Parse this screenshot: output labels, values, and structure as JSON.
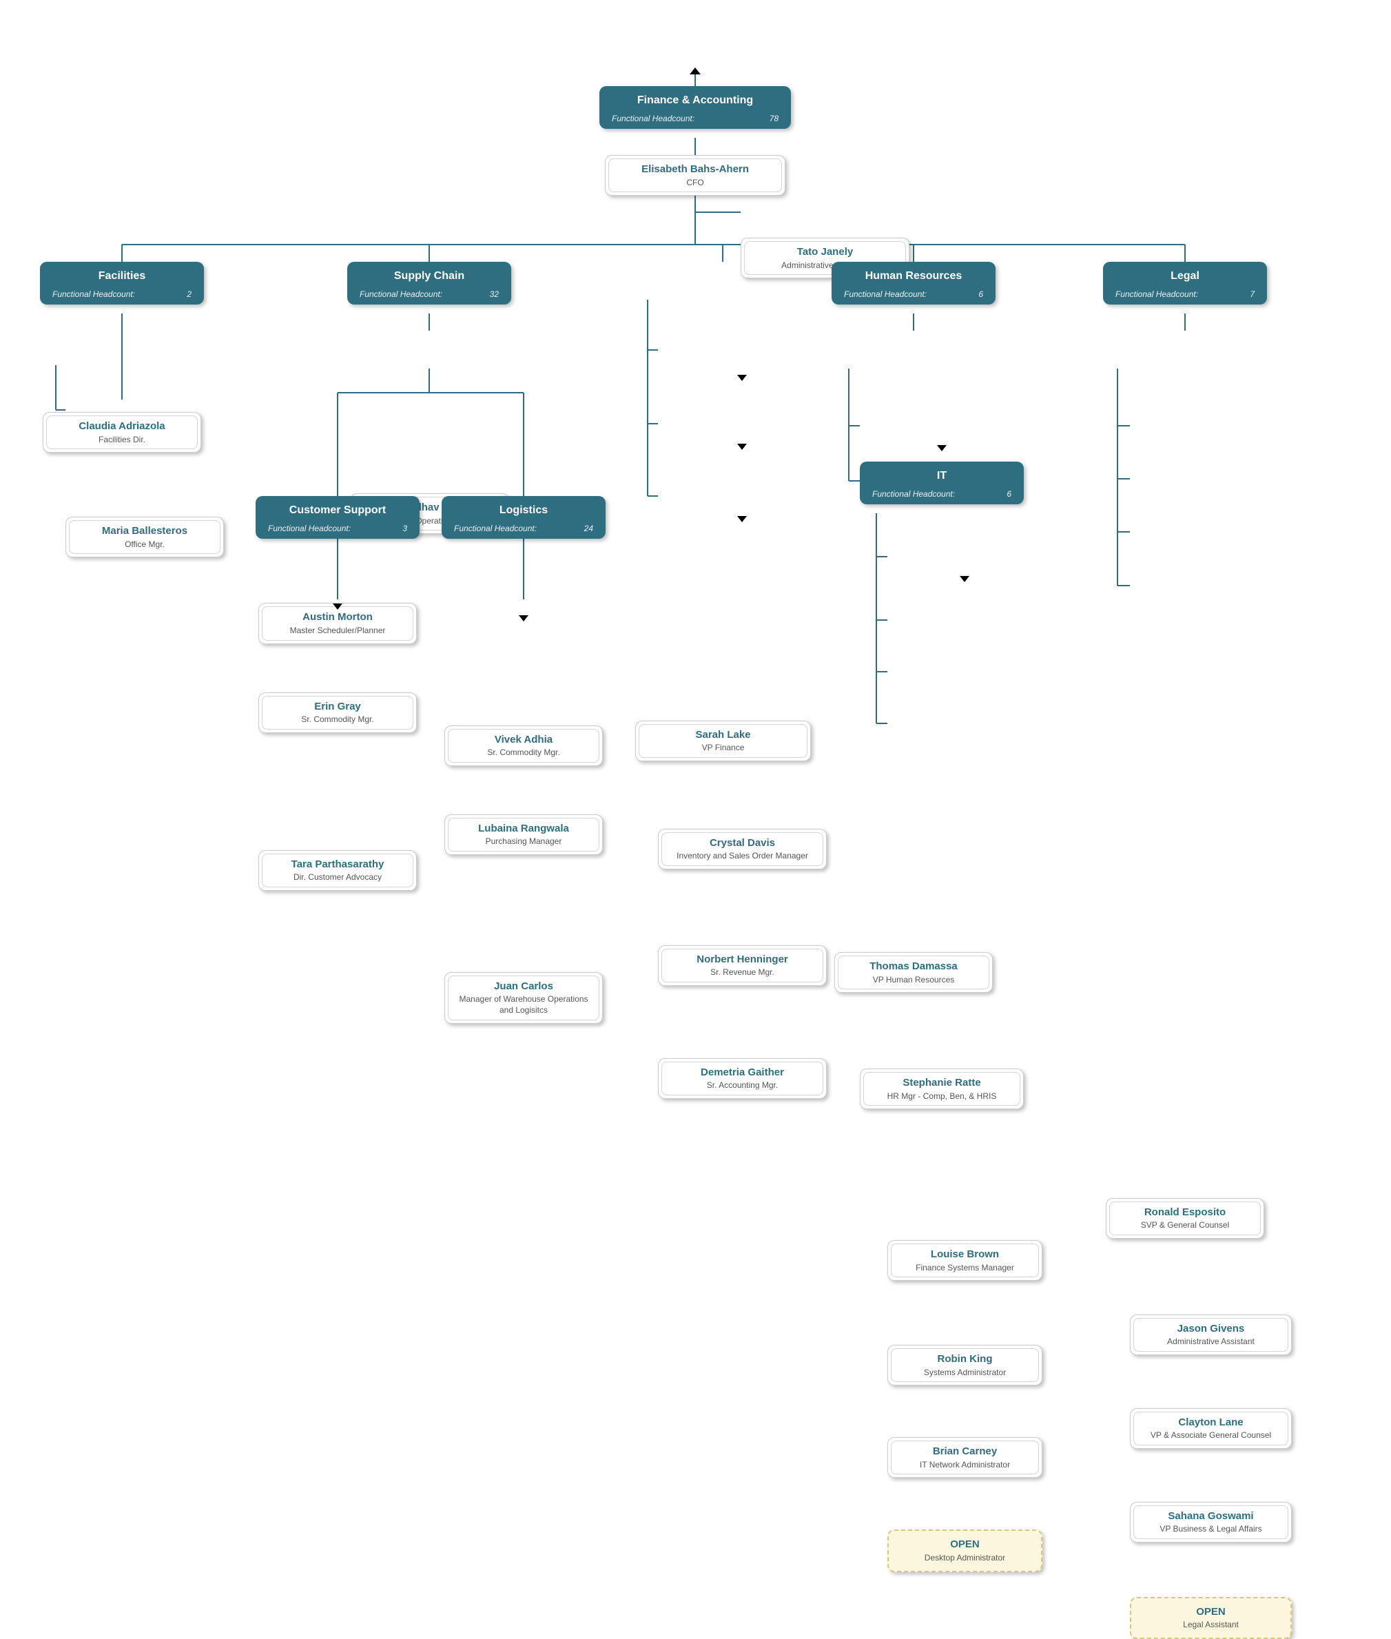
{
  "meta_label": "Functional Headcount:",
  "depts": {
    "root": {
      "title": "Finance & Accounting",
      "count": "78"
    },
    "facilities": {
      "title": "Facilities",
      "count": "2"
    },
    "supply": {
      "title": "Supply Chain",
      "count": "32"
    },
    "hr": {
      "title": "Human Resources",
      "count": "6"
    },
    "legal": {
      "title": "Legal",
      "count": "7"
    },
    "cust": {
      "title": "Customer Support",
      "count": "3"
    },
    "logistics": {
      "title": "Logistics",
      "count": "24"
    },
    "it": {
      "title": "IT",
      "count": "6"
    }
  },
  "people": {
    "cfo": {
      "name": "Elisabeth Bahs-Ahern",
      "title": "CFO"
    },
    "tato": {
      "name": "Tato Janely",
      "title": "Administrative Assistant"
    },
    "claudia": {
      "name": "Claudia Adriazola",
      "title": "Facilities Dir."
    },
    "maria": {
      "name": "Maria Ballesteros",
      "title": "Office Mgr."
    },
    "madhav": {
      "name": "Madhav Pai",
      "title": "VP Operations"
    },
    "austin": {
      "name": "Austin Morton",
      "title": "Master Scheduler/Planner"
    },
    "erin": {
      "name": "Erin Gray",
      "title": "Sr. Commodity Mgr."
    },
    "vivek": {
      "name": "Vivek Adhia",
      "title": "Sr. Commodity Mgr."
    },
    "lubaina": {
      "name": "Lubaina Rangwala",
      "title": "Purchasing Manager"
    },
    "tara": {
      "name": "Tara Parthasarathy",
      "title": "Dir. Customer Advocacy"
    },
    "juan": {
      "name": "Juan Carlos",
      "title": "Manager of Warehouse Operations and Logisitcs"
    },
    "sarah": {
      "name": "Sarah Lake",
      "title": "VP Finance"
    },
    "crystal": {
      "name": "Crystal Davis",
      "title": "Inventory and Sales Order Manager"
    },
    "norbert": {
      "name": "Norbert Henninger",
      "title": "Sr. Revenue Mgr."
    },
    "demetria": {
      "name": "Demetria Gaither",
      "title": "Sr. Accounting Mgr."
    },
    "thomas": {
      "name": "Thomas Damassa",
      "title": "VP Human Resources"
    },
    "stephanie": {
      "name": "Stephanie Ratte",
      "title": "HR Mgr - Comp, Ben, & HRIS"
    },
    "louise": {
      "name": "Louise Brown",
      "title": "Finance Systems Manager"
    },
    "robin": {
      "name": "Robin King",
      "title": "Systems Administrator"
    },
    "brian": {
      "name": "Brian Carney",
      "title": "IT Network Administrator"
    },
    "open_it": {
      "name": "OPEN",
      "title": "Desktop Administrator"
    },
    "ronald": {
      "name": "Ronald Esposito",
      "title": "SVP & General Counsel"
    },
    "jason": {
      "name": "Jason Givens",
      "title": "Administrative Assistant"
    },
    "clayton": {
      "name": "Clayton Lane",
      "title": "VP & Associate General Counsel"
    },
    "sahana": {
      "name": "Sahana Goswami",
      "title": "VP Business & Legal Affairs"
    },
    "open_legal": {
      "name": "OPEN",
      "title": "Legal Assistant"
    }
  }
}
